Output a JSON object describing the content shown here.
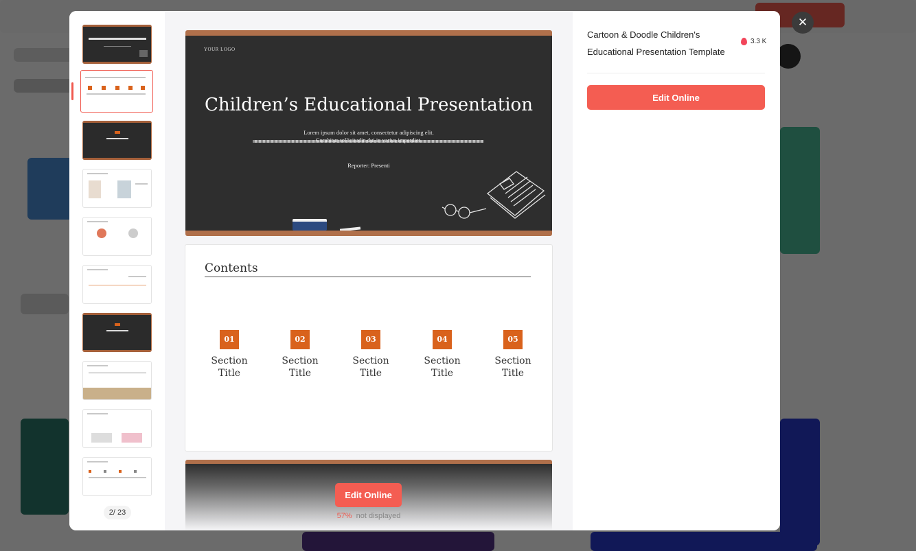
{
  "modal": {
    "info": {
      "title": "Cartoon & Doodle Children's Educational Presentation Template",
      "views": "3.3 K",
      "edit_button_label": "Edit Online"
    },
    "pager": {
      "current": "2",
      "total": "/ 23"
    },
    "slide1": {
      "logo": "YOUR LOGO",
      "title": "Children’s Educational Presentation",
      "subtitle_line1": "Lorem ipsum dolor sit amet, consectetur adipiscing elit.",
      "subtitle_line2": "Curabitur sollicitudin dui in varius imperdiet.",
      "reporter": "Reporter: Presenti"
    },
    "slide2": {
      "title": "Contents",
      "sections": [
        {
          "num": "01",
          "label": "Section Title"
        },
        {
          "num": "02",
          "label": "Section Title"
        },
        {
          "num": "03",
          "label": "Section Title"
        },
        {
          "num": "04",
          "label": "Section Title"
        },
        {
          "num": "05",
          "label": "Section Title"
        }
      ]
    },
    "preview_footer": {
      "edit_button_label": "Edit Online",
      "percent": "57%",
      "percent_note": "not displayed"
    }
  },
  "colors": {
    "accent": "#f45d52",
    "chalkboard": "#2e2e2e",
    "frame": "#b0704b",
    "section_orange": "#d9621c"
  }
}
